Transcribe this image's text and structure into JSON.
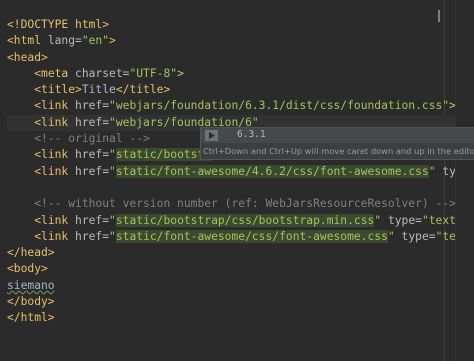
{
  "editor": {
    "lines": [
      [
        {
          "c": "tag",
          "t": "<!DOCTYPE html>"
        }
      ],
      [
        {
          "c": "tag",
          "t": "<html "
        },
        {
          "c": "attr",
          "t": "lang="
        },
        {
          "c": "str",
          "t": "\"en\""
        },
        {
          "c": "tag",
          "t": ">"
        }
      ],
      [
        {
          "c": "tag",
          "t": "<head>"
        }
      ],
      [
        {
          "c": "txt",
          "t": "    "
        },
        {
          "c": "tag",
          "t": "<meta "
        },
        {
          "c": "attr",
          "t": "charset="
        },
        {
          "c": "str",
          "t": "\"UTF-8\""
        },
        {
          "c": "tag",
          "t": ">"
        }
      ],
      [
        {
          "c": "txt",
          "t": "    "
        },
        {
          "c": "tag",
          "t": "<title>"
        },
        {
          "c": "txt",
          "t": "Title"
        },
        {
          "c": "tag",
          "t": "</title>"
        }
      ],
      [
        {
          "c": "txt",
          "t": "    "
        },
        {
          "c": "tag",
          "t": "<link "
        },
        {
          "c": "attr",
          "t": "href="
        },
        {
          "c": "str",
          "t": "\"webjars/foundation/6.3.1/dist/css/foundation.css\""
        },
        {
          "c": "tag",
          "t": ">"
        }
      ],
      [
        {
          "c": "txt",
          "t": "    "
        },
        {
          "c": "tag",
          "t": "<link "
        },
        {
          "c": "attr",
          "t": "href="
        },
        {
          "c": "str",
          "t": "\"webjars/foundation/6\""
        }
      ],
      [
        {
          "c": "txt",
          "t": "    "
        },
        {
          "c": "com",
          "t": "<!-- original -->"
        }
      ],
      [
        {
          "c": "txt",
          "t": "    "
        },
        {
          "c": "tag",
          "t": "<link "
        },
        {
          "c": "attr",
          "t": "href="
        },
        {
          "c": "str",
          "t": "\""
        },
        {
          "c": "lnk",
          "t": "static/bootstr"
        }
      ],
      [
        {
          "c": "txt",
          "t": "    "
        },
        {
          "c": "tag",
          "t": "<link "
        },
        {
          "c": "attr",
          "t": "href="
        },
        {
          "c": "str",
          "t": "\""
        },
        {
          "c": "lnk",
          "t": "static/font-awesome/4.6.2/css/font-awesome.css"
        },
        {
          "c": "str",
          "t": "\""
        },
        {
          "c": "txt",
          "t": " "
        },
        {
          "c": "attr",
          "t": "type="
        },
        {
          "c": "str",
          "t": "\""
        }
      ],
      [
        {
          "c": "txt",
          "t": ""
        }
      ],
      [
        {
          "c": "txt",
          "t": "    "
        },
        {
          "c": "com",
          "t": "<!-- without version number (ref: WebJarsResourceResolver) -->"
        }
      ],
      [
        {
          "c": "txt",
          "t": "    "
        },
        {
          "c": "tag",
          "t": "<link "
        },
        {
          "c": "attr",
          "t": "href="
        },
        {
          "c": "str",
          "t": "\""
        },
        {
          "c": "lnk",
          "t": "static/bootstrap/css/bootstrap.min.css"
        },
        {
          "c": "str",
          "t": "\""
        },
        {
          "c": "txt",
          "t": " "
        },
        {
          "c": "attr",
          "t": "type="
        },
        {
          "c": "str",
          "t": "\"text/css"
        }
      ],
      [
        {
          "c": "txt",
          "t": "    "
        },
        {
          "c": "tag",
          "t": "<link "
        },
        {
          "c": "attr",
          "t": "href="
        },
        {
          "c": "str",
          "t": "\""
        },
        {
          "c": "lnk",
          "t": "static/font-awesome/css/font-awesome.css"
        },
        {
          "c": "str",
          "t": "\""
        },
        {
          "c": "txt",
          "t": " "
        },
        {
          "c": "attr",
          "t": "type="
        },
        {
          "c": "str",
          "t": "\"text/c"
        }
      ],
      [
        {
          "c": "tag",
          "t": "</head>"
        }
      ],
      [
        {
          "c": "tag",
          "t": "<body>"
        }
      ],
      [
        {
          "c": "typo",
          "t": "siemano"
        }
      ],
      [
        {
          "c": "tag",
          "t": "</body>"
        }
      ],
      [
        {
          "c": "tag",
          "t": "</html>"
        }
      ]
    ],
    "current_line": 6
  },
  "popup": {
    "value": "6.3.1",
    "hint": "Ctrl+Down and Ctrl+Up will move caret down and up in the editor"
  }
}
